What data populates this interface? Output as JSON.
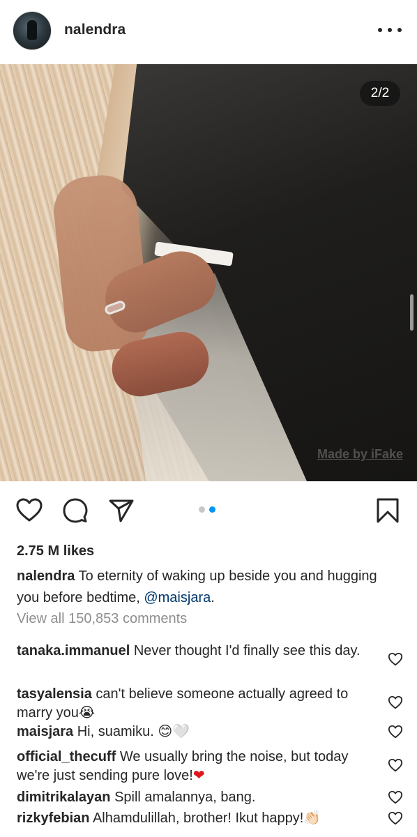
{
  "header": {
    "username": "nalendra",
    "avatar_icon": "profile-avatar",
    "more_icon": "more-horizontal-icon"
  },
  "post": {
    "counter": "2/2",
    "watermark": "Made by iFake"
  },
  "actions": {
    "like_icon": "heart-icon",
    "comment_icon": "comment-icon",
    "share_icon": "send-icon",
    "save_icon": "bookmark-icon",
    "carousel_index": 2,
    "carousel_total": 2,
    "accent_color": "#0095f6"
  },
  "likes": "2.75 M likes",
  "caption": {
    "username": "nalendra",
    "text": "To eternity of waking up beside you and hugging you before bedtime,",
    "mention": "@maisjara",
    "end": "."
  },
  "view_all": "View all 150,853 comments",
  "comments": [
    {
      "user": "tanaka.immanuel",
      "text": "Never thought I'd finally see this day.",
      "emoji": ""
    },
    {
      "user": "tasyalensia",
      "text": "can't believe someone actually agreed to marry you",
      "emoji": "😭"
    },
    {
      "user": "maisjara",
      "text": "Hi, suamiku.",
      "emoji": "😊🤍"
    },
    {
      "user": "official_thecuff",
      "text": "We usually bring the noise, but today we're just sending pure love!",
      "emoji": "❤"
    },
    {
      "user": "dimitrikalayan",
      "text": "Spill amalannya, bang.",
      "emoji": ""
    },
    {
      "user": "rizkyfebian",
      "text": "Alhamdulillah, brother! Ikut happy!",
      "emoji": "👏🏻"
    }
  ]
}
